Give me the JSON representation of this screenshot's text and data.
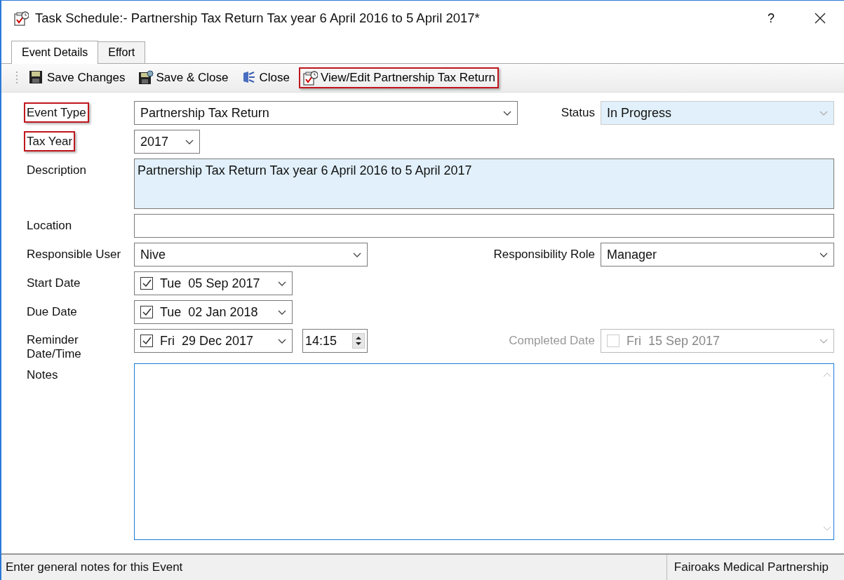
{
  "window": {
    "title": "Task Schedule:- Partnership Tax Return Tax year 6 April 2016 to 5 April 2017*",
    "help": "?"
  },
  "tabs": [
    {
      "label": "Event Details",
      "selected": true
    },
    {
      "label": "Effort",
      "selected": false
    }
  ],
  "toolbar": [
    {
      "kind": "save",
      "label": "Save Changes",
      "highlighted": false
    },
    {
      "kind": "save-close",
      "label": "Save & Close",
      "highlighted": false
    },
    {
      "kind": "close",
      "label": "Close",
      "highlighted": false
    },
    {
      "kind": "task",
      "label": "View/Edit Partnership Tax Return",
      "highlighted": true
    }
  ],
  "form": {
    "rows": [
      {
        "label": "Event Type",
        "highlighted": true,
        "controls": [
          {
            "kind": "dropdown",
            "value": "Partnership Tax Return",
            "shaded": false,
            "disabled": false
          }
        ],
        "right": {
          "label": "Status",
          "disabled": false,
          "control": {
            "kind": "dropdown",
            "value": "In Progress",
            "shaded": true,
            "disabled": true
          }
        }
      },
      {
        "label": "Tax Year",
        "highlighted": true,
        "controls": [
          {
            "kind": "dropdown",
            "value": "2017",
            "shaded": false,
            "disabled": false
          }
        ]
      },
      {
        "label": "Description",
        "highlighted": false,
        "controls": [
          {
            "kind": "memo",
            "value": "Partnership Tax Return Tax year 6 April 2016 to 5 April 2017",
            "shaded": true,
            "focused": false
          }
        ]
      },
      {
        "label": "Location",
        "highlighted": false,
        "controls": [
          {
            "kind": "text"
          }
        ]
      },
      {
        "label": "Responsible User",
        "highlighted": false,
        "controls": [
          {
            "kind": "dropdown",
            "value": "Nive",
            "shaded": false,
            "disabled": false
          }
        ],
        "right": {
          "label": "Responsibility Role",
          "disabled": false,
          "control": {
            "kind": "dropdown",
            "value": "Manager",
            "shaded": false,
            "disabled": false
          }
        }
      },
      {
        "label": "Start Date",
        "highlighted": false,
        "controls": [
          {
            "kind": "date",
            "checked": true,
            "day": "Tue",
            "date": "05 Sep 2017",
            "disabled": false
          }
        ]
      },
      {
        "label": "Due Date",
        "highlighted": false,
        "controls": [
          {
            "kind": "date",
            "checked": true,
            "day": "Tue",
            "date": "02 Jan 2018",
            "disabled": false
          }
        ]
      },
      {
        "label": "Reminder\nDate/Time",
        "highlighted": false,
        "controls": [
          {
            "kind": "date",
            "checked": true,
            "day": "Fri",
            "date": "29 Dec 2017",
            "disabled": false
          },
          {
            "kind": "time",
            "value": "14:15"
          }
        ],
        "right": {
          "label": "Completed Date",
          "disabled": true,
          "control": {
            "kind": "date",
            "checked": false,
            "day": "Fri",
            "date": "15 Sep 2017",
            "disabled": true
          }
        }
      },
      {
        "label": "Notes",
        "highlighted": false,
        "controls": [
          {
            "kind": "memo",
            "shaded": false,
            "focused": true
          }
        ]
      }
    ]
  },
  "status_bar": {
    "message": "Enter general notes for this Event",
    "company": "Fairoaks Medical Partnership"
  }
}
